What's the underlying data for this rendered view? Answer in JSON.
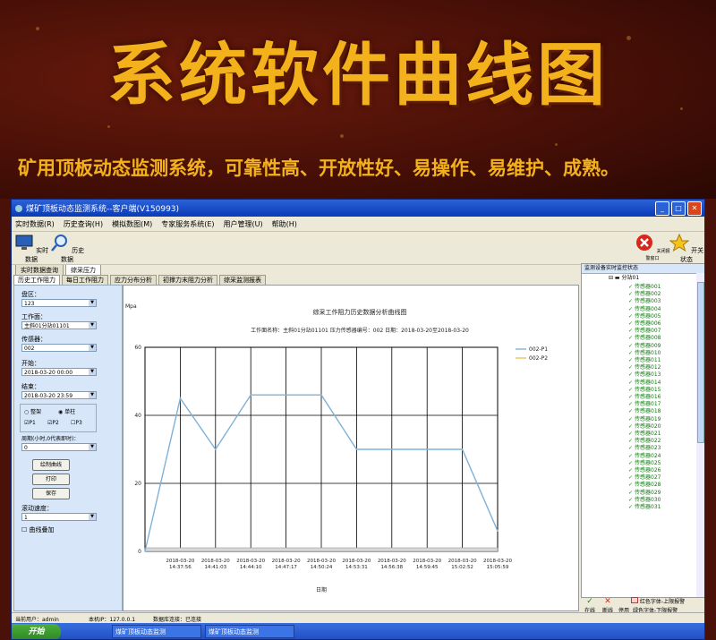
{
  "banner": {
    "title": "系统软件曲线图",
    "subtitle": "矿用顶板动态监测系统，可靠性高、开放性好、易操作、易维护、成熟。"
  },
  "window": {
    "title": "煤矿顶板动态监测系统--客户端(V150993)",
    "menu": [
      "实时数据(R)",
      "历史查询(H)",
      "模拟数图(M)",
      "专家服务系统(E)",
      "用户管理(U)",
      "帮助(H)"
    ],
    "toolbar": {
      "realtime": "实时数据",
      "history": "历史数据",
      "alarm_off": "关闭报警窗口",
      "toggle": "开关状态"
    },
    "tabs_top": [
      "实时数据查询",
      "综采压力"
    ],
    "tabs_second": [
      "历史工作阻力",
      "每日工作阻力",
      "应力分布分析",
      "初撑力末阻力分析",
      "综采监测报表"
    ],
    "form": {
      "district_label": "盘区：",
      "district_value": "123",
      "face_label": "工作面：",
      "face_value": "主斜01分站01101",
      "sensor_label": "传感器：",
      "sensor_value": "002",
      "start_label": "开始：",
      "start_value": "2018-03-20 00:00",
      "end_label": "结束：",
      "end_value": "2018-03-20 23:59",
      "radio_whole": "整架",
      "radio_single": "单柱",
      "cb_p1": "P1",
      "cb_p2": "P2",
      "cb_p3": "P3",
      "period_label": "周期(小时,0代表即时)：",
      "period_value": "0",
      "btn_draw": "绘制曲线",
      "btn_print": "打印",
      "btn_save": "保存",
      "scroll_label": "滚动速度：",
      "scroll_value": "1",
      "overlay_label": "曲线叠加"
    },
    "right_panel": {
      "title": "监测设备实时监控状态",
      "root": "分站01",
      "sensors": [
        "传感器001",
        "传感器002",
        "传感器003",
        "传感器004",
        "传感器005",
        "传感器006",
        "传感器007",
        "传感器008",
        "传感器009",
        "传感器010",
        "传感器011",
        "传感器012",
        "传感器013",
        "传感器014",
        "传感器015",
        "传感器016",
        "传感器017",
        "传感器018",
        "传感器019",
        "传感器020",
        "传感器021",
        "传感器022",
        "传感器023",
        "传感器024",
        "传感器025",
        "传感器026",
        "传感器027",
        "传感器028",
        "传感器029",
        "传感器030",
        "传感器031"
      ],
      "legend_ok": "在线",
      "legend_off": "断线",
      "legend_stop": "停用",
      "legend_red": "红色字体-上限报警",
      "legend_green": "绿色字体-下限报警"
    },
    "status": {
      "user": "当前用户：admin",
      "ip": "本机IP：127.0.0.1",
      "db": "数据库连接：已连接"
    },
    "taskbar": {
      "start": "开始",
      "task1": "煤矿顶板动态监测",
      "task2": "煤矿顶板动态监测"
    }
  },
  "chart_data": {
    "type": "line",
    "title": "综采工作阻力历史数据分析曲线图",
    "subtitle": "工作面名称：主斜01分站01101  压力传感器编号：002  日期：2018-03-20至2018-03-20",
    "ylabel": "Mpa",
    "xlabel": "日期",
    "ylim": [
      0,
      60
    ],
    "yticks": [
      0,
      20,
      40,
      60
    ],
    "grid": true,
    "legend_position": "top-right",
    "x": [
      "2018-03-20 14:37:56",
      "2018-03-20 14:41:03",
      "2018-03-20 14:44:10",
      "2018-03-20 14:47:17",
      "2018-03-20 14:50:24",
      "2018-03-20 14:53:31",
      "2018-03-20 14:56:38",
      "2018-03-20 14:59:45",
      "2018-03-20 15:02:52",
      "2018-03-20 15:05:59"
    ],
    "series": [
      {
        "name": "002-P1",
        "color": "#7fb2d8",
        "points": [
          [
            0,
            0
          ],
          [
            1,
            45
          ],
          [
            2,
            30
          ],
          [
            3,
            46
          ],
          [
            5,
            46
          ],
          [
            6,
            30
          ],
          [
            9,
            30
          ],
          [
            10,
            6
          ]
        ]
      },
      {
        "name": "002-P2",
        "color": "#e8c060",
        "points": []
      }
    ]
  }
}
